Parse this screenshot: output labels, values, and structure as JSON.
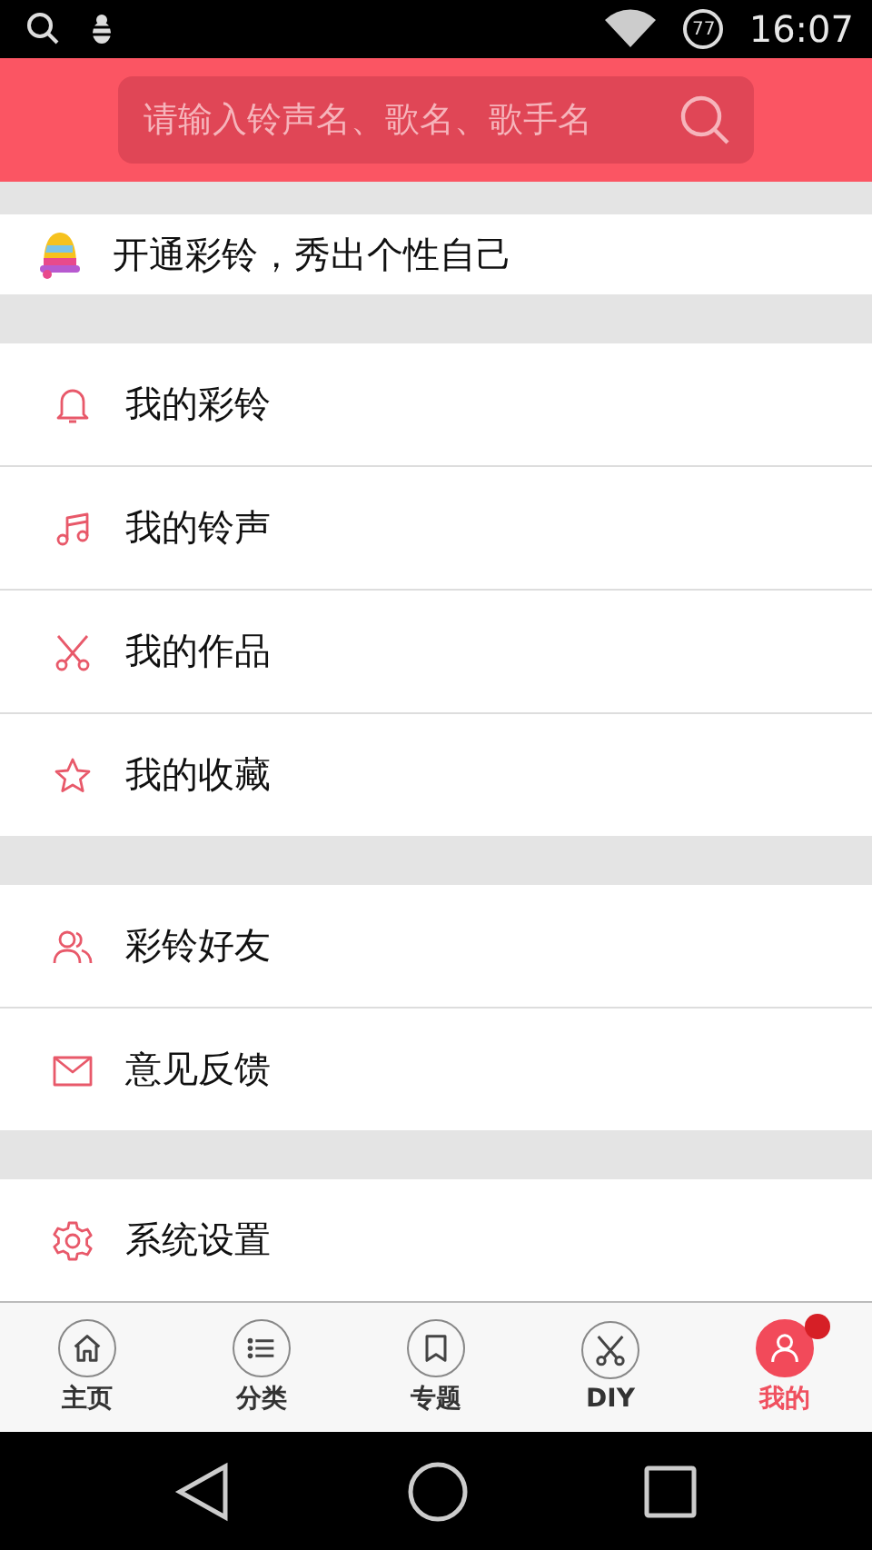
{
  "status_bar": {
    "battery": "77",
    "time": "16:07"
  },
  "search": {
    "placeholder": "请输入铃声名、歌名、歌手名"
  },
  "promo": {
    "text": "开通彩铃，秀出个性自己"
  },
  "groups": [
    {
      "items": [
        {
          "kind": "bell",
          "label": "我的彩铃"
        },
        {
          "kind": "note",
          "label": "我的铃声"
        },
        {
          "kind": "scissors",
          "label": "我的作品"
        },
        {
          "kind": "star",
          "label": "我的收藏"
        }
      ]
    },
    {
      "items": [
        {
          "kind": "friends",
          "label": "彩铃好友"
        },
        {
          "kind": "mail",
          "label": "意见反馈"
        }
      ]
    },
    {
      "items": [
        {
          "kind": "gear",
          "label": "系统设置"
        }
      ]
    }
  ],
  "tabs": [
    {
      "kind": "home",
      "label": "主页",
      "selected": false,
      "badge": false
    },
    {
      "kind": "list",
      "label": "分类",
      "selected": false,
      "badge": false
    },
    {
      "kind": "bookmark",
      "label": "专题",
      "selected": false,
      "badge": false
    },
    {
      "kind": "scissors",
      "label": "DIY",
      "selected": false,
      "badge": false
    },
    {
      "kind": "person",
      "label": "我的",
      "selected": true,
      "badge": true
    }
  ]
}
